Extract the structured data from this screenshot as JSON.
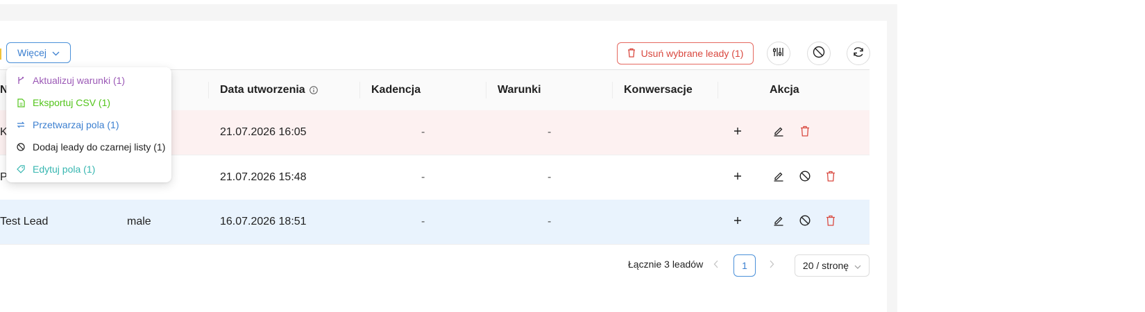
{
  "toolbar": {
    "more_label": "Więcej",
    "delete_selected_label": "Usuń wybrane leady (1)"
  },
  "dropdown": {
    "items": [
      {
        "label": "Aktualizuj warunki (1)",
        "color": "#9b59b6",
        "icon": "branch-icon"
      },
      {
        "label": "Eksportuj CSV (1)",
        "color": "#52c41a",
        "icon": "file-export-icon"
      },
      {
        "label": "Przetwarzaj pola (1)",
        "color": "#3b7fd0",
        "icon": "swap-icon"
      },
      {
        "label": "Dodaj leady do czarnej listy (1)",
        "color": "#1f1f1f",
        "icon": "block-icon"
      },
      {
        "label": "Edytuj pola (1)",
        "color": "#36b6b0",
        "icon": "tag-icon"
      }
    ]
  },
  "table": {
    "columns": {
      "name": "N",
      "created": "Data utworzenia",
      "cadence": "Kadencja",
      "conditions": "Warunki",
      "conversations": "Konwersacje",
      "action": "Akcja"
    },
    "rows": [
      {
        "name": "K",
        "gender": "",
        "created": "21.07.2026 16:05",
        "cadence": "-",
        "conditions": "-"
      },
      {
        "name": "P",
        "gender": "",
        "created": "21.07.2026 15:48",
        "cadence": "-",
        "conditions": "-"
      },
      {
        "name": "Test Lead",
        "gender": "male",
        "created": "16.07.2026 18:51",
        "cadence": "-",
        "conditions": "-"
      }
    ]
  },
  "pagination": {
    "total_label": "Łącznie 3 leadów",
    "current_page": "1",
    "page_size_label": "20 / stronę"
  },
  "colors": {
    "accent": "#3b7fd0",
    "danger": "#d9483f",
    "selected_row": "#fdf1f1",
    "highlight_row": "#e9f3fd"
  }
}
